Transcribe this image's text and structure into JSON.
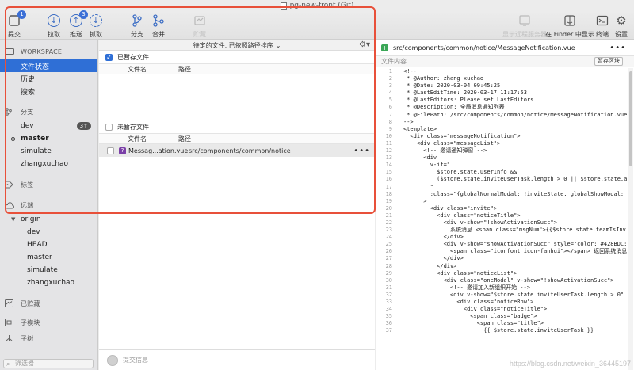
{
  "window": {
    "title": "pg-new-front (Git)"
  },
  "toolbar": {
    "left": [
      {
        "key": "commit",
        "label": "提交",
        "icon": "commit-icon",
        "badge": "1"
      },
      {
        "key": "pull",
        "label": "拉取",
        "icon": "pull-icon"
      },
      {
        "key": "push",
        "label": "推送",
        "icon": "push-icon",
        "badge": "3"
      },
      {
        "key": "fetch",
        "label": "抓取",
        "icon": "fetch-icon"
      },
      {
        "key": "branch",
        "label": "分支",
        "icon": "branch-icon"
      },
      {
        "key": "merge",
        "label": "合并",
        "icon": "merge-icon"
      },
      {
        "key": "stash",
        "label": "贮藏",
        "icon": "stash-icon",
        "disabled": true
      }
    ],
    "right": [
      {
        "key": "show_remote",
        "label": "显示远程服务器",
        "icon": "remote-server-icon",
        "disabled": true
      },
      {
        "key": "finder",
        "label": "在 Finder 中显示",
        "icon": "finder-icon"
      },
      {
        "key": "terminal",
        "label": "终端",
        "icon": "terminal-icon"
      },
      {
        "key": "settings",
        "label": "设置",
        "icon": "gear-icon"
      }
    ]
  },
  "sidebar": {
    "workspace_label": "WORKSPACE",
    "workspace_items": [
      "文件状态",
      "历史",
      "搜索"
    ],
    "branches_label": "分支",
    "branches": [
      {
        "name": "dev",
        "badge": "3↑"
      },
      {
        "name": "master",
        "current": true
      },
      {
        "name": "simulate"
      },
      {
        "name": "zhangxuchao"
      }
    ],
    "tags_label": "标签",
    "remotes_label": "远端",
    "remote_name": "origin",
    "remote_branches": [
      "dev",
      "HEAD",
      "master",
      "simulate",
      "zhangxuchao"
    ],
    "stashes_label": "已贮藏",
    "submodules_label": "子模块",
    "subtrees_label": "子树",
    "search_placeholder": "筛选器"
  },
  "middle": {
    "header": "待定的文件, 已依照路径排序",
    "staged": {
      "title": "已暂存文件",
      "col_name": "文件名",
      "col_path": "路径"
    },
    "unstaged": {
      "title": "未暂存文件",
      "col_name": "文件名",
      "col_path": "路径",
      "files": [
        {
          "status": "?",
          "name": "Messag...ation.vue",
          "path": "src/components/common/notice"
        }
      ]
    },
    "commit_placeholder": "提交信息"
  },
  "right": {
    "file_path": "src/components/common/notice/MessageNotification.vue",
    "content_label": "文件内容",
    "stage_button": "暂存区块",
    "lines": [
      {
        "n": "1",
        "t": "<!--"
      },
      {
        "n": "2",
        "t": " * @Author: zhang xuchao"
      },
      {
        "n": "3",
        "t": " * @Date: 2020-03-04 09:45:25"
      },
      {
        "n": "4",
        "t": " * @LastEditTime: 2020-03-17 11:17:53"
      },
      {
        "n": "5",
        "t": " * @LastEditors: Please set LastEditors"
      },
      {
        "n": "6",
        "t": " * @Description: 全局消息通知列表"
      },
      {
        "n": "7",
        "t": " * @FilePath: /src/components/common/notice/MessageNotification.vue"
      },
      {
        "n": "8",
        "t": "-->"
      },
      {
        "n": "9",
        "t": "<template>"
      },
      {
        "n": "10",
        "t": "  <div class=\"messageNotification\">"
      },
      {
        "n": "11",
        "t": "    <div class=\"messageList\">"
      },
      {
        "n": "12",
        "t": "      <!-- 邀请通知弹窗 -->"
      },
      {
        "n": "13",
        "t": "      <div"
      },
      {
        "n": "14",
        "t": "        v-if=\""
      },
      {
        "n": "15",
        "t": "          $store.state.userInfo &&"
      },
      {
        "n": "16",
        "t": "          ($store.state.inviteUserTask.length > 0 || $store.state.a"
      },
      {
        "n": "17",
        "t": "        \""
      },
      {
        "n": "18",
        "t": "        :class=\"{globalNormalModal: !inviteState, globalShowModal:"
      },
      {
        "n": "19",
        "t": "      >"
      },
      {
        "n": "20",
        "t": "        <div class=\"invite\">"
      },
      {
        "n": "21",
        "t": "          <div class=\"noticeTitle\">"
      },
      {
        "n": "22",
        "t": "            <div v-show=\"!showActivationSucc\">"
      },
      {
        "n": "23",
        "t": "              系统消息 <span class=\"msgNum\">{{$store.state.teamIsInv"
      },
      {
        "n": "24",
        "t": "            </div>"
      },
      {
        "n": "25",
        "t": "            <div v-show=\"showActivationSucc\" style=\"color: #428BDC;"
      },
      {
        "n": "26",
        "t": "              <span class=\"iconfont icon-fanhui\"></span> 返回系统消息"
      },
      {
        "n": "27",
        "t": "            </div>"
      },
      {
        "n": "28",
        "t": "          </div>"
      },
      {
        "n": "29",
        "t": "          <div class=\"noticeList\">"
      },
      {
        "n": "30",
        "t": "            <div class=\"oneModal\" v-show=\"!showActivationSucc\">"
      },
      {
        "n": "31",
        "t": "              <!-- 邀请加入新组织开始 -->"
      },
      {
        "n": "32",
        "t": "              <div v-show=\"$store.state.inviteUserTask.length > 0\""
      },
      {
        "n": "33",
        "t": "                <div class=\"noticeRow\">"
      },
      {
        "n": "34",
        "t": "                  <div class=\"noticeTitle\">"
      },
      {
        "n": "35",
        "t": "                    <span class=\"badge\">"
      },
      {
        "n": "36",
        "t": "                      <span class=\"title\">"
      },
      {
        "n": "37",
        "t": "                        {{ $store.state.inviteUserTask }}"
      }
    ]
  },
  "watermark": "https://blog.csdn.net/weixin_36445197",
  "colors": {
    "accent": "#2f6fd6",
    "highlight": "#e8503a",
    "added": "#3aa757"
  }
}
